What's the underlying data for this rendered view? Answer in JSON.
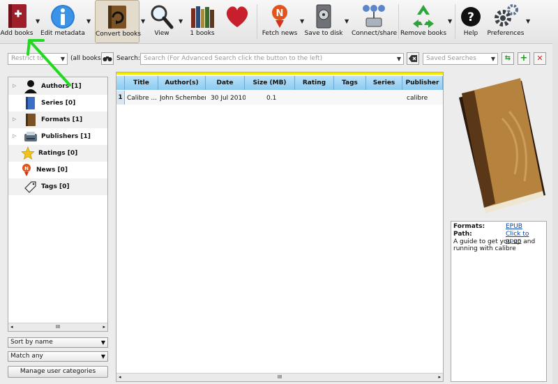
{
  "toolbar": {
    "add_books": "Add books",
    "edit_metadata": "Edit metadata",
    "convert_books": "Convert books",
    "view": "View",
    "library": "1 books",
    "fetch_news": "Fetch news",
    "save_to_disk": "Save to disk",
    "connect_share": "Connect/share",
    "remove_books": "Remove books",
    "help": "Help",
    "preferences": "Preferences"
  },
  "search": {
    "restrict_placeholder": "Restrict to",
    "all_books": "(all books)",
    "label": "Search:",
    "placeholder": "Search (For Advanced Search click the button to the left)",
    "saved_searches": "Saved Searches"
  },
  "tag_browser": {
    "items": [
      {
        "label": "Authors [1]"
      },
      {
        "label": "Series [0]"
      },
      {
        "label": "Formats [1]"
      },
      {
        "label": "Publishers [1]"
      },
      {
        "label": "Ratings [0]"
      },
      {
        "label": "News [0]"
      },
      {
        "label": "Tags [0]"
      }
    ],
    "sort_by": "Sort by name",
    "match": "Match any",
    "manage": "Manage user categories"
  },
  "book_list": {
    "columns": [
      "Title",
      "Author(s)",
      "Date",
      "Size (MB)",
      "Rating",
      "Tags",
      "Series",
      "Publisher"
    ],
    "rows": [
      {
        "num": "1",
        "title": "Calibre ...",
        "author": "John Schember",
        "date": "30 Jul 2010",
        "size": "0.1",
        "rating": "",
        "tags": "",
        "series": "",
        "publisher": "calibre"
      }
    ]
  },
  "details": {
    "formats_label": "Formats:",
    "formats_value": "EPUB",
    "path_label": "Path:",
    "path_value": "Click to open",
    "description": "A guide to get you up and running with calibre"
  },
  "colors": {
    "header_blue": "#8dcbf0",
    "highlight_yellow": "#f2ec00",
    "annotation_green": "#22d922"
  }
}
